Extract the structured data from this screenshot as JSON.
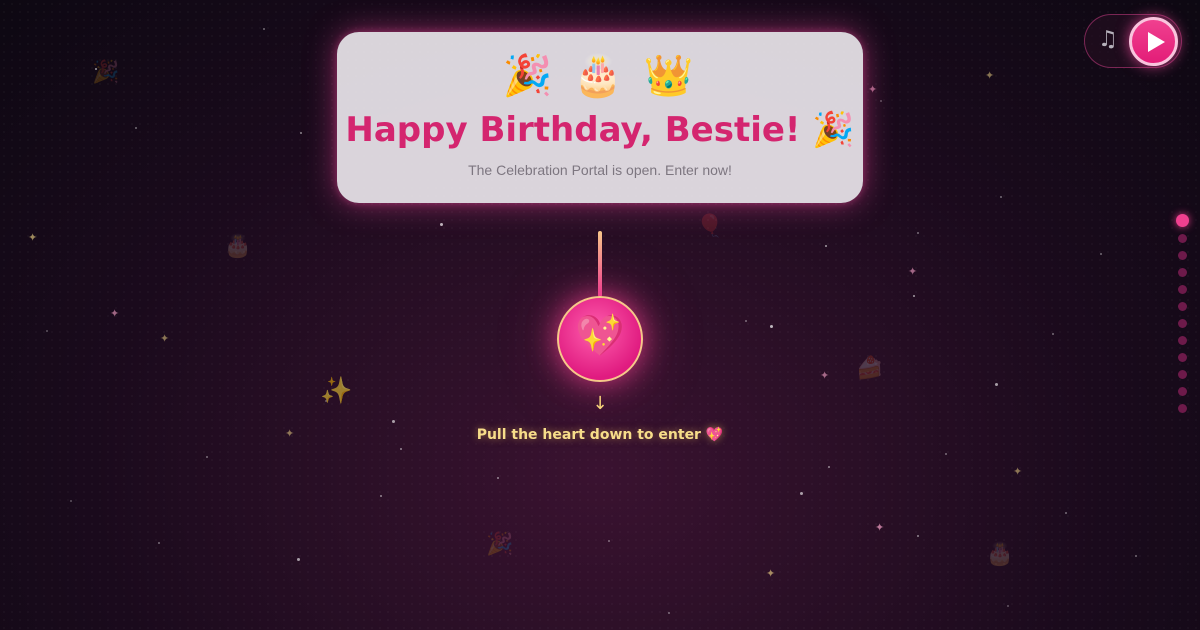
{
  "header": {
    "emojis": "🎉 🎂 👑",
    "title": "Happy Birthday, Bestie! 🎉",
    "subtitle": "The Celebration Portal is open. Enter now!"
  },
  "music": {
    "note_icon": "♫",
    "play_icon": "play-icon"
  },
  "portal": {
    "heart_icon": "💖",
    "arrow_icon": "↓",
    "instruction": "Pull the heart down to enter 💖"
  },
  "section_nav": {
    "count": 12,
    "active_index": 0
  },
  "colors": {
    "accent": "#f0408f",
    "title": "#d4256f",
    "instruction": "#f7dd8a",
    "background": "#1a0a1c"
  }
}
